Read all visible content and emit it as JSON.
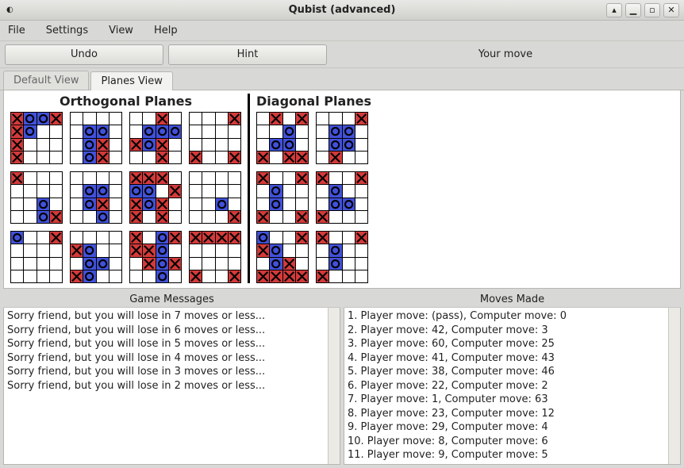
{
  "window": {
    "title": "Qubist (advanced)"
  },
  "menubar": {
    "items": [
      "File",
      "Settings",
      "View",
      "Help"
    ]
  },
  "toolbar": {
    "undo": "Undo",
    "hint": "Hint",
    "status": "Your move"
  },
  "tabs": {
    "items": [
      {
        "label": "Default View",
        "active": false
      },
      {
        "label": "Planes View",
        "active": true
      }
    ]
  },
  "planes": {
    "orthogonal_title": "Orthogonal Planes",
    "diagonal_title": "Diagonal Planes"
  },
  "boards": {
    "legend": {
      "X": "red X (player/computer)",
      "O": "blue O",
      ".": "empty"
    },
    "note": "Each board is 4 rows × 4 cols, row-major string of 16 chars using X O .",
    "orthogonal": [
      [
        "XOOX XO.. X... X...",
        ".... .OO. .OX. .OX.",
        "..X. .OOO XOX. ..X.",
        "...X .... .... X..X"
      ],
      [
        "X... .... ..O. ..OX",
        ".... .OO. .OX. ..O.",
        "XXX. OO.X XOX. X.X.",
        ".... .... ..O. ...X"
      ],
      [
        "O..X .... .... ....",
        ".... XO.. .OO. XO..",
        "X.OX XXO. .XOX ..O.",
        "XXXX .... .... X..X"
      ]
    ],
    "diagonal": [
      [
        ".X.X ..O. .OO. X.XX",
        "...X .OO. .OO. .X.."
      ],
      [
        "X..X .O.. .O.. X..X",
        "X..X .O.. .OO. X..."
      ],
      [
        "O..X XO.. .OX. XXXX",
        "X..X .O.. .O.. X..."
      ]
    ]
  },
  "game_messages": {
    "title": "Game Messages",
    "lines": [
      "Sorry friend, but you will lose in 7 moves or less...",
      "Sorry friend, but you will lose in 6 moves or less...",
      "Sorry friend, but you will lose in 5 moves or less...",
      "Sorry friend, but you will lose in 4 moves or less...",
      "Sorry friend, but you will lose in 3 moves or less...",
      "Sorry friend, but you will lose in 2 moves or less..."
    ]
  },
  "moves_made": {
    "title": "Moves Made",
    "lines": [
      "1. Player move: (pass), Computer move: 0",
      "2. Player move: 42, Computer move: 3",
      "3. Player move: 60, Computer move: 25",
      "4. Player move: 41, Computer move: 43",
      "5. Player move: 38, Computer move: 46",
      "6. Player move: 22, Computer move: 2",
      "7. Player move: 1, Computer move: 63",
      "8. Player move: 23, Computer move: 12",
      "9. Player move: 29, Computer move: 4",
      "10. Player move: 8, Computer move: 6",
      "11. Player move: 9, Computer move: 5"
    ]
  }
}
